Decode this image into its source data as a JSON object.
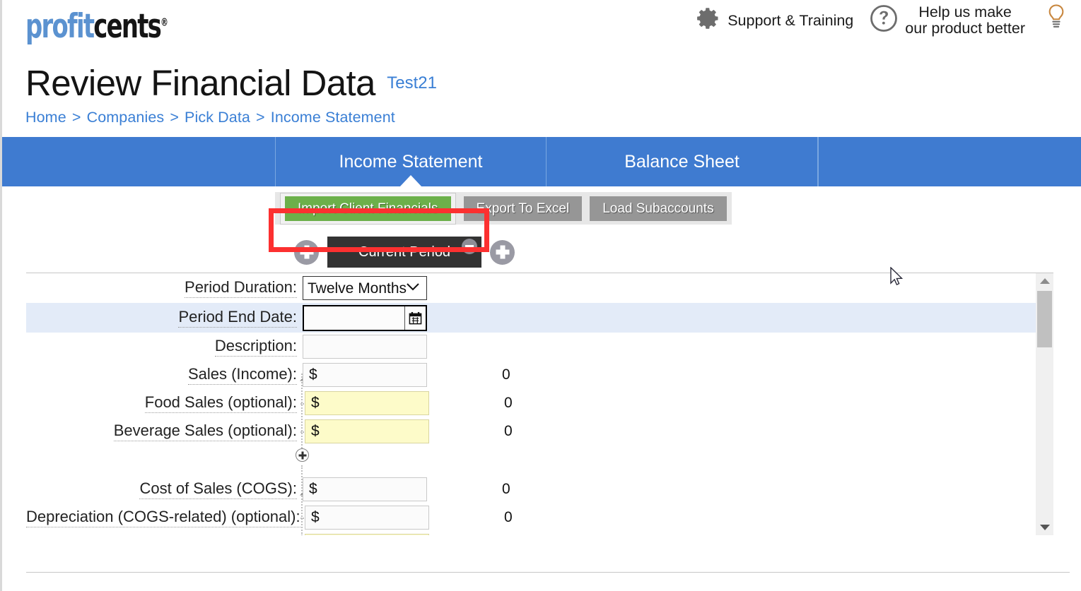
{
  "header": {
    "logo": {
      "part1": "profit",
      "part2": "cents",
      "trademark": "®"
    },
    "support_label": "Support & Training",
    "feedback_line1": "Help us make",
    "feedback_line2": "our product better",
    "icons": {
      "gear": "gear-icon",
      "question": "question-circle-icon",
      "bulb": "lightbulb-icon"
    }
  },
  "title": {
    "page_title": "Review Financial Data",
    "company": "Test21"
  },
  "breadcrumb": {
    "items": [
      "Home",
      "Companies",
      "Pick Data",
      "Income Statement"
    ],
    "separator": ">"
  },
  "nav": {
    "tabs": [
      {
        "label": "Income Statement",
        "active": true
      },
      {
        "label": "Balance Sheet",
        "active": false
      }
    ]
  },
  "toolbar": {
    "import_label": "Import Client Financials",
    "export_label": "Export To Excel",
    "subaccounts_label": "Load Subaccounts",
    "highlight_color": "#fc3030",
    "import_color": "#6cb04a",
    "default_color": "#969696"
  },
  "periods": {
    "add_left_label": "+",
    "add_right_label": "+",
    "current_tab_label": "Current Period",
    "remove_label": "-"
  },
  "form": {
    "rows": [
      {
        "label": "Period Duration:",
        "type": "select",
        "value": "Twelve Months",
        "options": [
          "Twelve Months"
        ],
        "highlight": false
      },
      {
        "label": "Period End Date:",
        "type": "date",
        "value": "",
        "placeholder": "",
        "highlight": true
      },
      {
        "label": "Description:",
        "type": "text",
        "value": "",
        "placeholder": "",
        "highlight": false
      },
      {
        "label": "Sales (Income):",
        "type": "money",
        "currency": "$",
        "value": "0",
        "style": "white",
        "has_toggle": true,
        "highlight": false
      },
      {
        "label": "Food Sales (optional):",
        "type": "money",
        "currency": "$",
        "value": "0",
        "style": "yellow",
        "child": true,
        "highlight": false
      },
      {
        "label": "Beverage Sales (optional):",
        "type": "money",
        "currency": "$",
        "value": "0",
        "style": "yellow",
        "child": true,
        "highlight": false
      },
      {
        "label": "Cost of Sales (COGS):",
        "type": "money",
        "currency": "$",
        "value": "0",
        "style": "white",
        "has_toggle": true,
        "highlight": false
      },
      {
        "label": "Depreciation (COGS-related) (optional):",
        "type": "money",
        "currency": "$",
        "value": "0",
        "style": "white",
        "child": true,
        "highlight": false
      }
    ],
    "add_subaccount_label": "+"
  },
  "scrollbar": {
    "up_label": "▲",
    "down_label": "▼",
    "thumb_position": "top"
  },
  "colors": {
    "nav_blue": "#3f7bd0",
    "link_blue": "#3a7fd5",
    "row_highlight": "#e3ebf8",
    "yellow_field": "#fdfbc9"
  }
}
